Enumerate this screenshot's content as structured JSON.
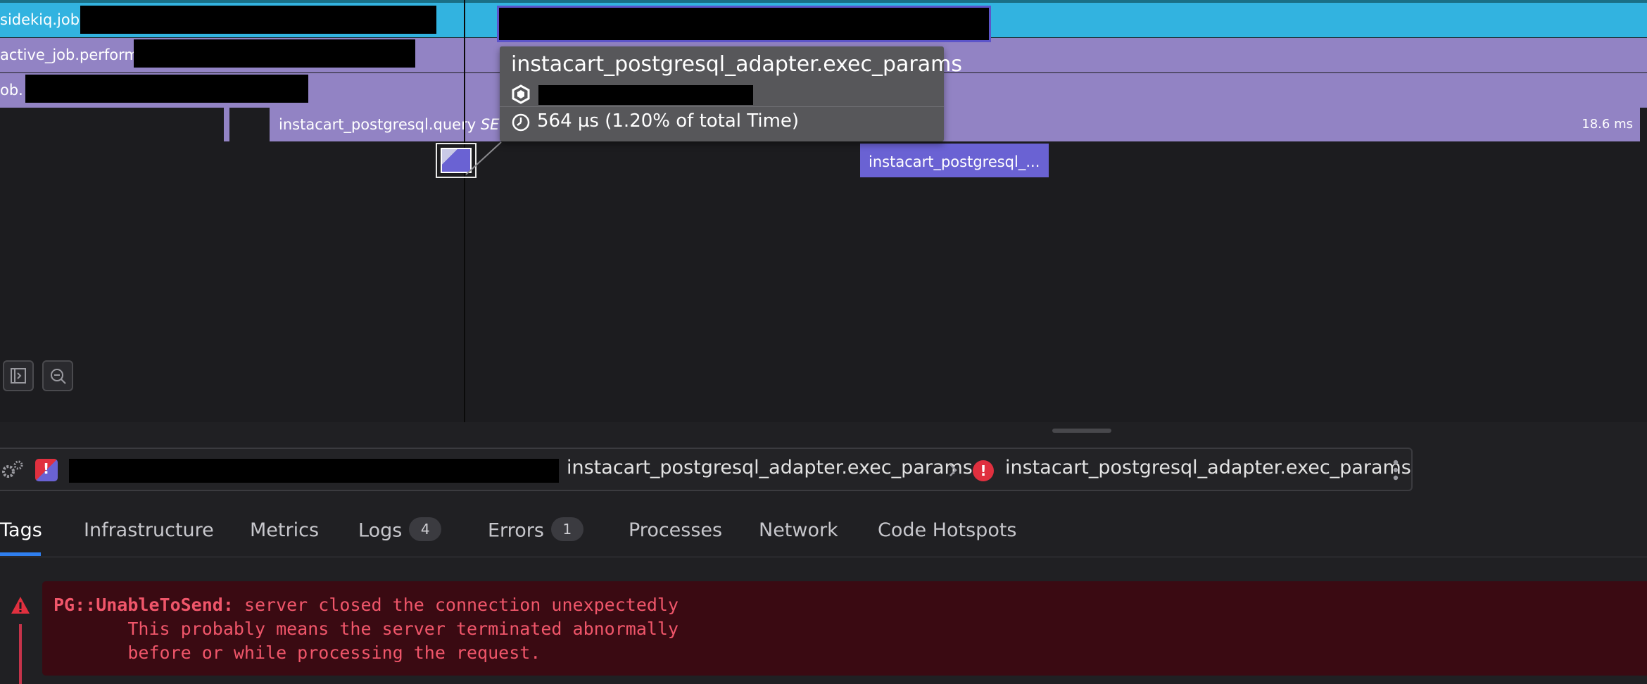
{
  "flame_rows": {
    "row1_label": "sidekiq.job",
    "row2_label": "active_job.perform",
    "row3_label": "ob.",
    "query_span_label": "instacart_postgresql.query",
    "query_span_suffix": "SEL",
    "query_duration": "18.6 ms",
    "exec_span_label": "instacart_postgresql_..."
  },
  "tooltip": {
    "title": "instacart_postgresql_adapter.exec_params",
    "time": "564 µs (1.20% of total Time)",
    "service_icon": "hexagon-service-icon",
    "time_icon": "clock-icon"
  },
  "breadcrumb": {
    "item1": "instacart_postgresql_adapter.exec_params",
    "item2": "instacart_postgresql_adapter.exec_params"
  },
  "tabs": [
    {
      "label": "Tags"
    },
    {
      "label": "Infrastructure"
    },
    {
      "label": "Metrics"
    },
    {
      "label": "Logs",
      "count": "4"
    },
    {
      "label": "Errors",
      "count": "1"
    },
    {
      "label": "Processes"
    },
    {
      "label": "Network"
    },
    {
      "label": "Code Hotspots"
    }
  ],
  "error": {
    "type": "PG::UnableToSend:",
    "line1": " server closed the connection unexpectedly",
    "line2": "       This probably means the server terminated abnormally",
    "line3": "       before or while processing the request."
  },
  "colors": {
    "sidekiq_row": "#32b3e0",
    "job_rows": "#9283c4",
    "exec_span": "#6a62d3",
    "error_bg": "#3a0a12",
    "error_text": "#f0566a",
    "tab_active": "#2f7ff0"
  }
}
